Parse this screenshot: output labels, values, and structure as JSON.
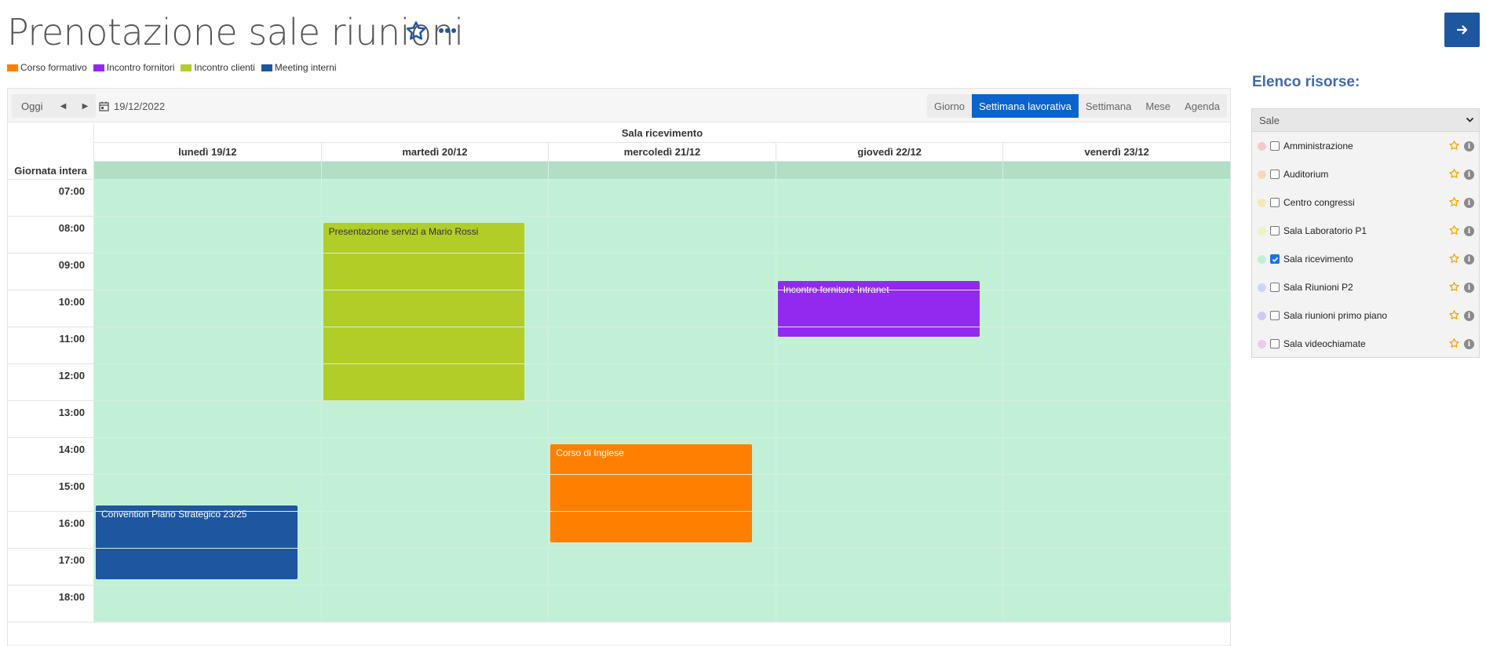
{
  "header": {
    "title": "Prenotazione sale riunioni"
  },
  "legend": [
    {
      "label": "Corso formativo",
      "color": "#ff8000"
    },
    {
      "label": "Incontro fornitori",
      "color": "#9329ef"
    },
    {
      "label": "Incontro clienti",
      "color": "#b2cd28"
    },
    {
      "label": "Meeting interni",
      "color": "#1e56a0"
    }
  ],
  "toolbar": {
    "today_label": "Oggi",
    "date": "19/12/2022",
    "views": [
      "Giorno",
      "Settimana lavorativa",
      "Settimana",
      "Mese",
      "Agenda"
    ],
    "active_view": "Settimana lavorativa"
  },
  "calendar": {
    "resource": "Sala ricevimento",
    "days": [
      "lunedì 19/12",
      "martedì 20/12",
      "mercoledì 21/12",
      "giovedì 22/12",
      "venerdì 23/12"
    ],
    "allday_label": "Giornata intera",
    "hours": [
      "07:00",
      "08:00",
      "09:00",
      "10:00",
      "11:00",
      "12:00",
      "13:00",
      "14:00",
      "15:00",
      "16:00",
      "17:00",
      "18:00"
    ],
    "events": [
      {
        "title": "Presentazione servizi a Mario Rossi",
        "day": 1,
        "start": "08:10",
        "end": "13:00",
        "color": "#b2cd28",
        "text_color": "#333333"
      },
      {
        "title": "Incontro fornitore Intranet",
        "day": 3,
        "start": "09:45",
        "end": "11:15",
        "color": "#9329ef",
        "text_color": "#ffffff"
      },
      {
        "title": "Corso di Inglese",
        "day": 2,
        "start": "14:10",
        "end": "16:50",
        "color": "#ff8000",
        "text_color": "#ffffff"
      },
      {
        "title": "Convention Piano Strategico 23/25",
        "day": 0,
        "start": "15:50",
        "end": "17:50",
        "color": "#1e56a0",
        "text_color": "#ffffff"
      }
    ]
  },
  "resources_panel": {
    "title": "Elenco risorse:",
    "select_value": "Sale",
    "items": [
      {
        "label": "Amministrazione",
        "dot_color": "#f5c9c9",
        "checked": false
      },
      {
        "label": "Auditorium",
        "dot_color": "#f8d9b7",
        "checked": false
      },
      {
        "label": "Centro congressi",
        "dot_color": "#f7e8b5",
        "checked": false
      },
      {
        "label": "Sala Laboratorio P1",
        "dot_color": "#eef3c1",
        "checked": false
      },
      {
        "label": "Sala ricevimento",
        "dot_color": "#c2f0d7",
        "checked": true
      },
      {
        "label": "Sala Riunioni P2",
        "dot_color": "#c7d8f7",
        "checked": false
      },
      {
        "label": "Sala riunioni primo piano",
        "dot_color": "#cfc9f6",
        "checked": false
      },
      {
        "label": "Sala videochiamate",
        "dot_color": "#f2c7ef",
        "checked": false
      }
    ]
  }
}
